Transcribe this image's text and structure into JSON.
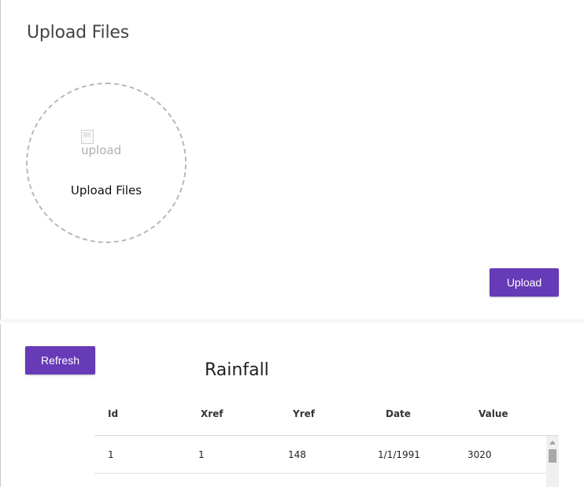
{
  "upload": {
    "title": "Upload Files",
    "dropzone_image_alt": "upload",
    "dropzone_label": "Upload Files",
    "upload_button": "Upload"
  },
  "table_section": {
    "refresh_button": "Refresh",
    "title": "Rainfall",
    "columns": [
      "Id",
      "Xref",
      "Yref",
      "Date",
      "Value"
    ],
    "rows": [
      [
        "1",
        "1",
        "148",
        "1/1/1991",
        "3020"
      ]
    ]
  },
  "colors": {
    "primary": "#673ab7",
    "dashed_border": "#b8b8b8"
  },
  "icons": {
    "dropzone": "broken-image-icon",
    "scroll_up": "scroll-up-arrow-icon"
  }
}
